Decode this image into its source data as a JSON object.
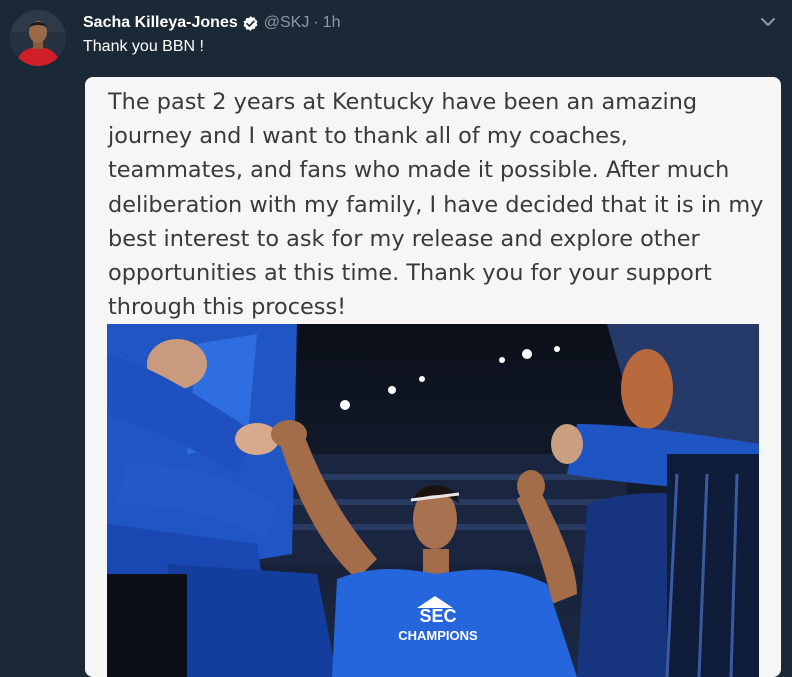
{
  "tweet": {
    "author_name": "Sacha Killeya-Jones",
    "handle": "@SKJ",
    "separator": "·",
    "time": "1h",
    "text": "Thank you BBN !"
  },
  "card": {
    "statement": "The past 2 years at Kentucky have been an amazing journey and I want to thank all of my coaches, teammates, and fans who made it possible. After much deliberation with my family, I have decided that it is in my best interest to ask for my release and explore other opportunities at this time. Thank you for your support through this process!"
  },
  "photo": {
    "shirt_line1": "SEC",
    "shirt_line2": "CHAMPIONS"
  },
  "colors": {
    "background": "#1b2836",
    "secondary_text": "#8899a6",
    "verified_blue": "#1da1f2",
    "kentucky_blue": "#1d4fb8"
  },
  "icons": {
    "verified": "verified-badge-icon",
    "menu": "chevron-down-icon"
  }
}
